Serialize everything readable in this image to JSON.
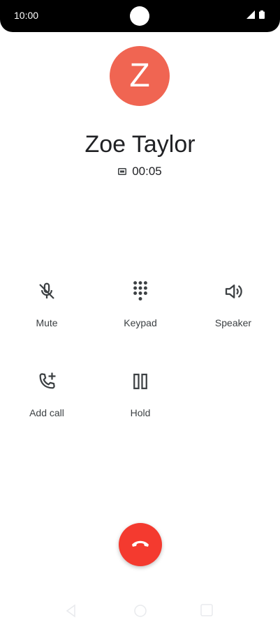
{
  "status_bar": {
    "time": "10:00"
  },
  "contact": {
    "initial": "Z",
    "name": "Zoe Taylor",
    "avatar_color": "#f06552"
  },
  "call": {
    "duration": "00:05",
    "hd_icon": "hd-icon"
  },
  "controls": [
    {
      "label": "Mute",
      "icon": "mic-off-icon"
    },
    {
      "label": "Keypad",
      "icon": "dialpad-icon"
    },
    {
      "label": "Speaker",
      "icon": "speaker-icon"
    },
    {
      "label": "Add call",
      "icon": "add-call-icon"
    },
    {
      "label": "Hold",
      "icon": "pause-icon"
    }
  ],
  "end_call": {
    "icon": "call-end-icon",
    "color": "#f43a2f"
  },
  "nav": {
    "back_icon": "back-icon",
    "home_icon": "home-icon",
    "recents_icon": "recents-icon"
  }
}
